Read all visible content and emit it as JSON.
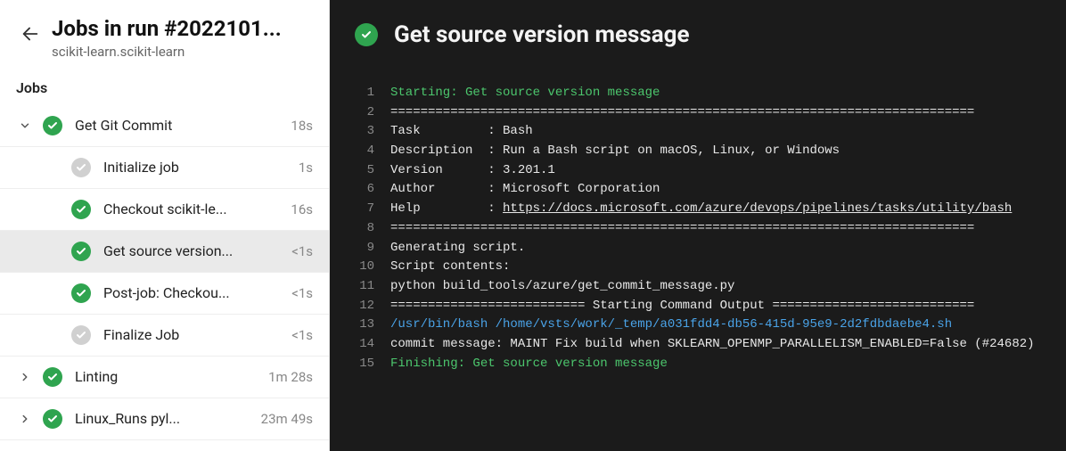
{
  "header": {
    "title": "Jobs in run #2022101...",
    "subtitle": "scikit-learn.scikit-learn"
  },
  "sections": {
    "jobs_heading": "Jobs"
  },
  "jobs": [
    {
      "name": "Get Git Commit",
      "status": "success",
      "expanded": true,
      "duration": "18s",
      "steps": [
        {
          "name": "Initialize job",
          "status": "muted",
          "duration": "1s",
          "selected": false
        },
        {
          "name": "Checkout scikit-le...",
          "status": "success",
          "duration": "16s",
          "selected": false
        },
        {
          "name": "Get source version...",
          "status": "success",
          "duration": "<1s",
          "selected": true
        },
        {
          "name": "Post-job: Checkou...",
          "status": "success",
          "duration": "<1s",
          "selected": false
        },
        {
          "name": "Finalize Job",
          "status": "muted",
          "duration": "<1s",
          "selected": false
        }
      ]
    },
    {
      "name": "Linting",
      "status": "success",
      "expanded": false,
      "duration": "1m 28s",
      "steps": []
    },
    {
      "name": "Linux_Runs pyl...",
      "status": "success",
      "expanded": false,
      "duration": "23m 49s",
      "steps": []
    }
  ],
  "log": {
    "title": "Get source version message",
    "status": "success",
    "lines": [
      {
        "n": 1,
        "cls": "green",
        "text": "Starting: Get source version message"
      },
      {
        "n": 2,
        "cls": "",
        "text": "=============================================================================="
      },
      {
        "n": 3,
        "cls": "",
        "text": "Task         : Bash"
      },
      {
        "n": 4,
        "cls": "",
        "text": "Description  : Run a Bash script on macOS, Linux, or Windows"
      },
      {
        "n": 5,
        "cls": "",
        "text": "Version      : 3.201.1"
      },
      {
        "n": 6,
        "cls": "",
        "text": "Author       : Microsoft Corporation"
      },
      {
        "n": 7,
        "cls": "",
        "text": "Help         : ",
        "link": "https://docs.microsoft.com/azure/devops/pipelines/tasks/utility/bash"
      },
      {
        "n": 8,
        "cls": "",
        "text": "=============================================================================="
      },
      {
        "n": 9,
        "cls": "",
        "text": "Generating script."
      },
      {
        "n": 10,
        "cls": "",
        "text": "Script contents:"
      },
      {
        "n": 11,
        "cls": "",
        "text": "python build_tools/azure/get_commit_message.py"
      },
      {
        "n": 12,
        "cls": "",
        "text": "========================== Starting Command Output ==========================="
      },
      {
        "n": 13,
        "cls": "blue",
        "text": "/usr/bin/bash /home/vsts/work/_temp/a031fdd4-db56-415d-95e9-2d2fdbdaebe4.sh"
      },
      {
        "n": 14,
        "cls": "",
        "text": "commit message: MAINT Fix build when SKLEARN_OPENMP_PARALLELISM_ENABLED=False (#24682)"
      },
      {
        "n": 15,
        "cls": "green",
        "text": "Finishing: Get source version message"
      }
    ]
  }
}
